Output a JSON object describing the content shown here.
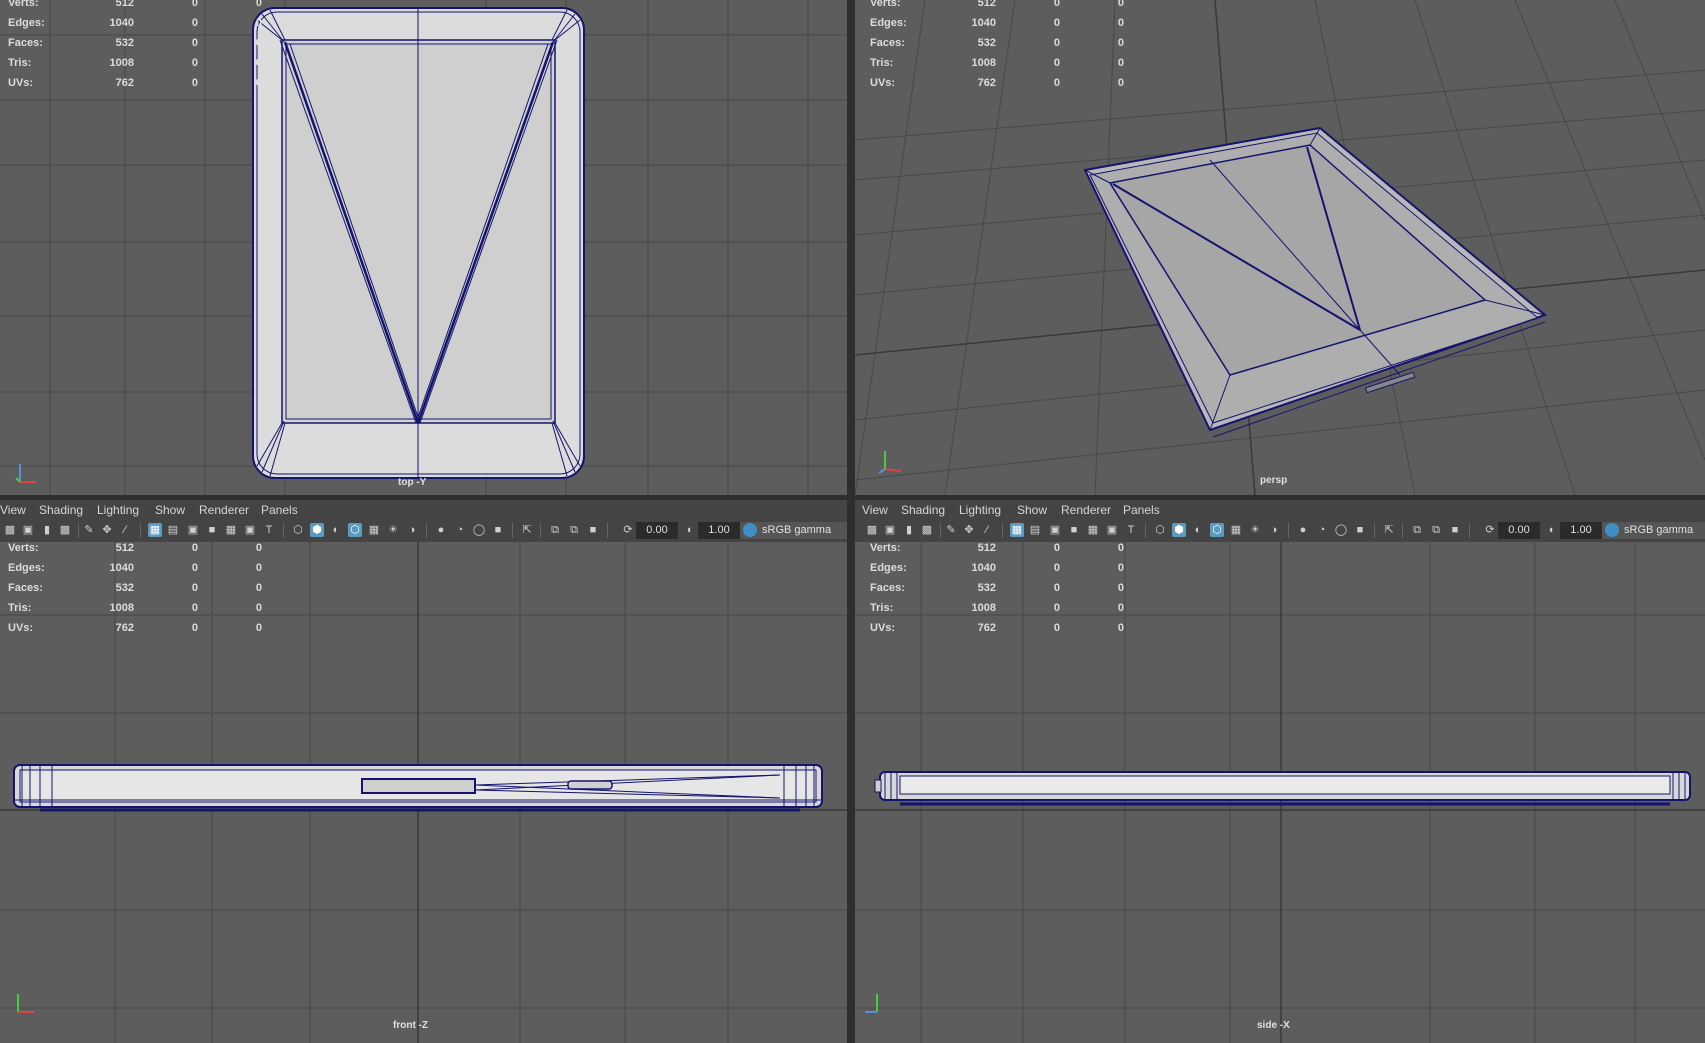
{
  "stats": {
    "rows": [
      {
        "label": "Verts:",
        "v1": "512",
        "v2": "0",
        "v3": "0"
      },
      {
        "label": "Edges:",
        "v1": "1040",
        "v2": "0",
        "v3": "0"
      },
      {
        "label": "Faces:",
        "v1": "532",
        "v2": "0",
        "v3": "0"
      },
      {
        "label": "Tris:",
        "v1": "1008",
        "v2": "0",
        "v3": "0"
      },
      {
        "label": "UVs:",
        "v1": "762",
        "v2": "0",
        "v3": "0"
      }
    ]
  },
  "menu": {
    "view": "View",
    "shading": "Shading",
    "lighting": "Lighting",
    "show": "Show",
    "renderer": "Renderer",
    "panels": "Panels"
  },
  "toolbar": {
    "exposure": "0.00",
    "gamma": "1.00",
    "colorspace": "sRGB gamma"
  },
  "viewports": {
    "top": {
      "camera": "top -Y"
    },
    "persp": {
      "camera": "persp"
    },
    "front": {
      "camera": "front -Z"
    },
    "side": {
      "camera": "side -X"
    }
  },
  "colors": {
    "viewport_bg": "#5d5d5d",
    "grid": "#484848",
    "wire": "#14146e",
    "panel": "#444444",
    "highlight": "#5c9bc0"
  }
}
